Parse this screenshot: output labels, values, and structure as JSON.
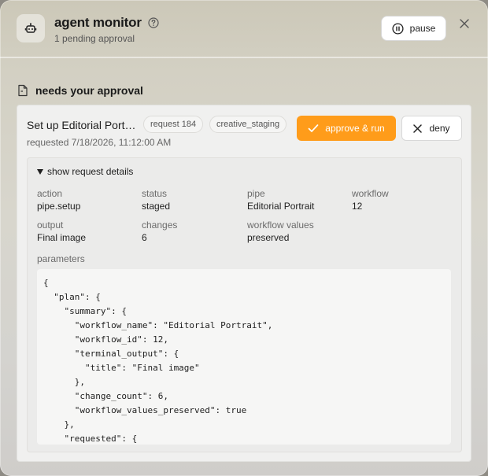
{
  "header": {
    "title": "agent monitor",
    "subtitle": "1 pending approval",
    "pause_label": "pause",
    "icons": {
      "agent": "robot-icon",
      "help": "help-circle-icon",
      "pause": "pause-circle-icon",
      "close": "close-icon"
    }
  },
  "section": {
    "title": "needs your approval",
    "icon": "document-icon"
  },
  "request": {
    "title": "Set up Editorial Portrait",
    "chips": [
      "request 184",
      "creative_staging"
    ],
    "approve_label": "approve & run",
    "deny_label": "deny",
    "requested_at": "requested 7/18/2026, 11:12:00 AM",
    "details": {
      "toggle_label": "show request details",
      "meta": [
        {
          "label": "action",
          "value": "pipe.setup"
        },
        {
          "label": "status",
          "value": "staged"
        },
        {
          "label": "pipe",
          "value": "Editorial Portrait"
        },
        {
          "label": "workflow",
          "value": "12"
        },
        {
          "label": "output",
          "value": "Final image"
        },
        {
          "label": "changes",
          "value": "6"
        },
        {
          "label": "workflow values",
          "value": "preserved"
        }
      ],
      "parameters_label": "parameters",
      "parameters_code": "{\n  \"plan\": {\n    \"summary\": {\n      \"workflow_name\": \"Editorial Portrait\",\n      \"workflow_id\": 12,\n      \"terminal_output\": {\n        \"title\": \"Final image\"\n      },\n      \"change_count\": 6,\n      \"workflow_values_preserved\": true\n    },\n    \"requested\": {"
    }
  },
  "colors": {
    "accent": "#ff9c1a",
    "card_bg": "#f0f0ef",
    "muted_text": "#6b6b6b"
  }
}
